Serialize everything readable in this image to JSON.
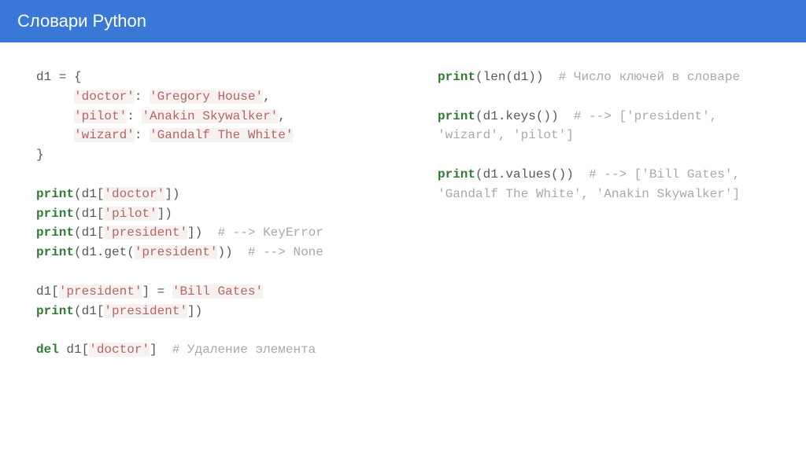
{
  "header": {
    "title": "Словари Python"
  },
  "code": {
    "left": {
      "l1": "d1 = {",
      "s2": "'doctor'",
      "l2a": ": ",
      "s2b": "'Gregory House'",
      "l2c": ",",
      "s3": "'pilot'",
      "l3a": ": ",
      "s3b": "'Anakin Skywalker'",
      "l3c": ",",
      "s4": "'wizard'",
      "l4a": ": ",
      "s4b": "'Gandalf The White'",
      "l5": "}",
      "kwPrint": "print",
      "kwDel": "del",
      "p1": "(d1[",
      "p1s": "'doctor'",
      "p1e": "])",
      "p2": "(d1[",
      "p2s": "'pilot'",
      "p2e": "])",
      "p3": "(d1[",
      "p3s": "'president'",
      "p3e": "])  ",
      "p3c": "# --> KeyError",
      "p4": "(d1.get(",
      "p4s": "'president'",
      "p4e": "))  ",
      "p4c": "# --> None",
      "a1": "d1[",
      "a1s": "'president'",
      "a1m": "] = ",
      "a1v": "'Bill Gates'",
      "p5": "(d1[",
      "p5s": "'president'",
      "p5e": "])",
      "d1": " d1[",
      "d1s": "'doctor'",
      "d1e": "]  ",
      "d1c": "# Удаление элемента"
    },
    "right": {
      "kwPrint": "print",
      "r1": "(len(d1))  ",
      "r1c": "# Число ключей в словаре",
      "r2": "(d1.keys())  ",
      "r2c": "# --> ['president', 'wizard', 'pilot']",
      "r3": "(d1.values())  ",
      "r3c": "# --> ['Bill Gates', 'Gandalf The White', 'Anakin Skywalker']"
    }
  }
}
